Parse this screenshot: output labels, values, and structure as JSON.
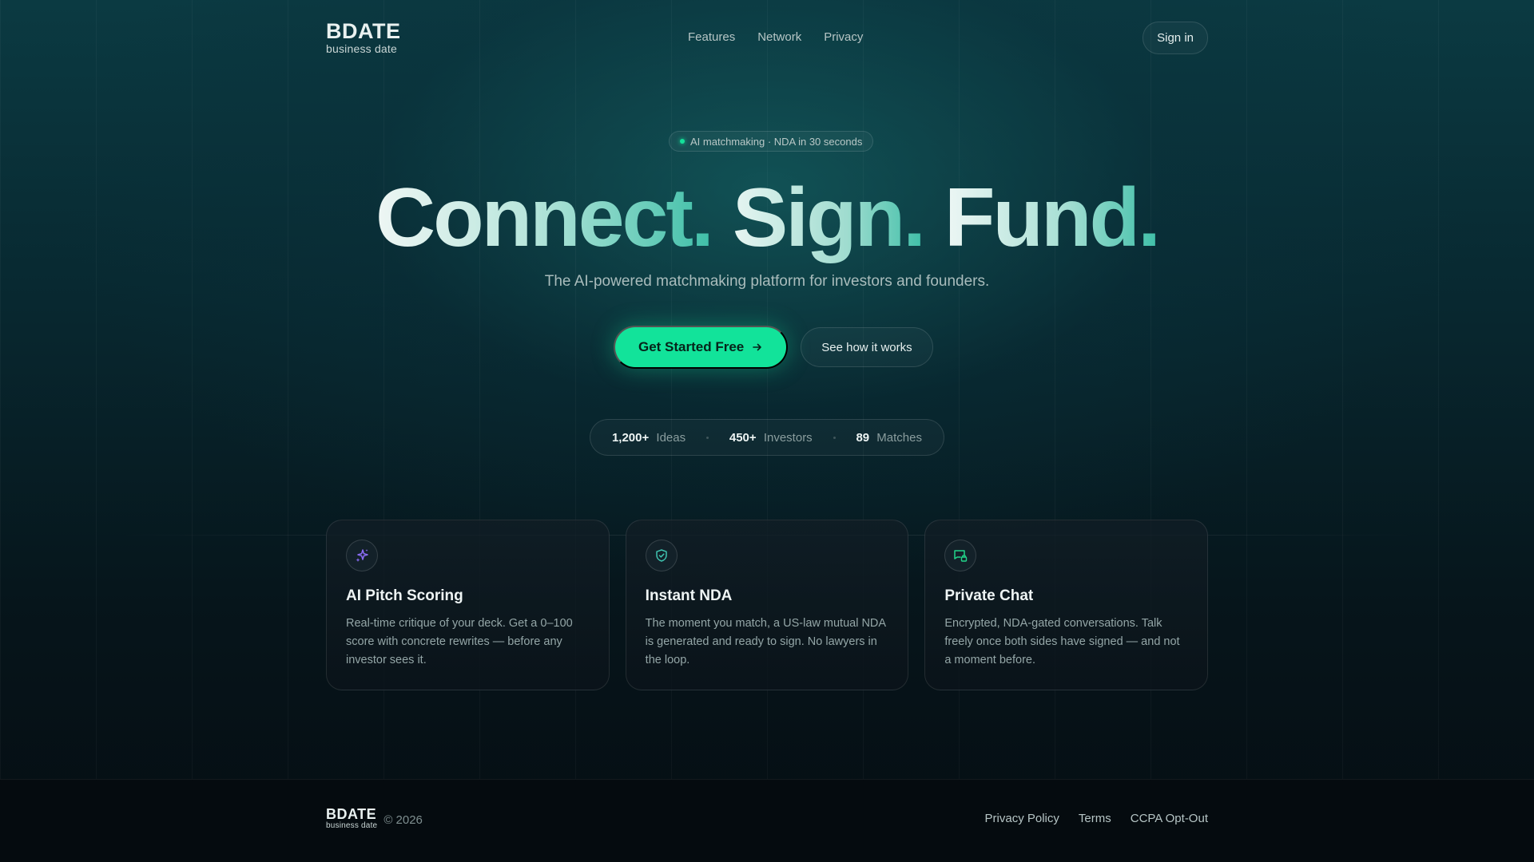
{
  "brand": {
    "mark": "BDATE",
    "sub": "business date"
  },
  "nav": {
    "items": [
      "Features",
      "Network",
      "Privacy"
    ]
  },
  "header": {
    "signin_label": "Sign in"
  },
  "badge": {
    "text": "AI matchmaking · NDA in 30 seconds"
  },
  "hero": {
    "words": [
      "Connect.",
      "Sign.",
      "Fund."
    ],
    "subtitle": "The AI-powered matchmaking platform for investors and founders.",
    "primary_cta": "Get Started Free",
    "secondary_cta": "See how it works"
  },
  "stats": [
    {
      "value": "1,200+",
      "label": "Ideas"
    },
    {
      "value": "450+",
      "label": "Investors"
    },
    {
      "value": "89",
      "label": "Matches"
    }
  ],
  "features": [
    {
      "icon": "sparkles-icon",
      "title": "AI Pitch Scoring",
      "text": "Real-time critique of your deck. Get a 0–100 score with concrete rewrites — before any investor sees it."
    },
    {
      "icon": "shield-check-icon",
      "title": "Instant NDA",
      "text": "The moment you match, a US-law mutual NDA is generated and ready to sign. No lawyers in the loop."
    },
    {
      "icon": "chat-lock-icon",
      "title": "Private Chat",
      "text": "Encrypted, NDA-gated conversations. Talk freely once both sides have signed — and not a moment before."
    }
  ],
  "footer": {
    "copyright": "© 2026",
    "links": [
      "Privacy Policy",
      "Terms",
      "CCPA Opt-Out"
    ]
  },
  "colors": {
    "accent": "#12e39a",
    "icon_purple": "#8b6cf5",
    "icon_teal": "#3fc3b0",
    "icon_green": "#22d68a"
  }
}
